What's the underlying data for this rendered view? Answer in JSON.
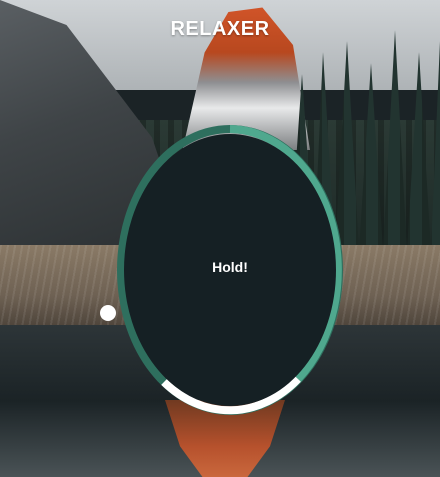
{
  "app": {
    "title": "RELAXER"
  },
  "breathing": {
    "instruction": "Hold!"
  },
  "ring": {
    "track_color": "#2e6f5e",
    "active_color": "#4fa88e",
    "progress_color": "#ffffff",
    "inner_color": "#152024"
  },
  "icons": {
    "handle": "progress-handle"
  }
}
